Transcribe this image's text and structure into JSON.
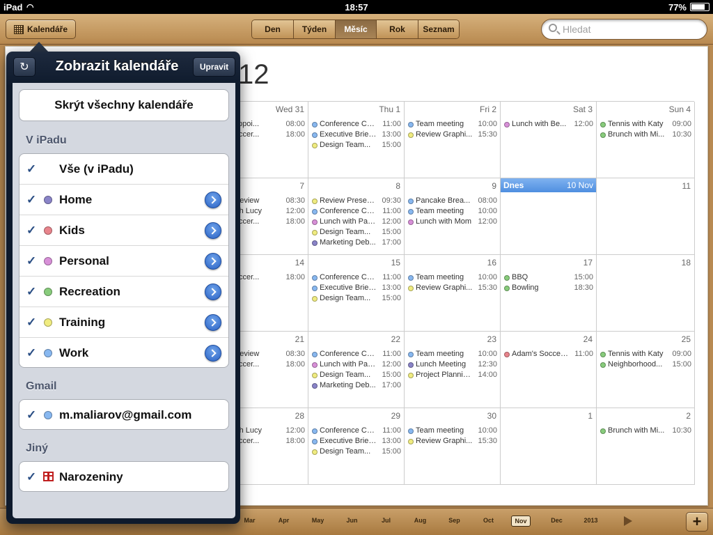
{
  "status_bar": {
    "device": "iPad",
    "time": "18:57",
    "battery": "77%"
  },
  "toolbar": {
    "calendars_label": "Kalendáře",
    "views": [
      {
        "label": "Den",
        "active": false
      },
      {
        "label": "Týden",
        "active": false
      },
      {
        "label": "Měsíc",
        "active": true
      },
      {
        "label": "Rok",
        "active": false
      },
      {
        "label": "Seznam",
        "active": false
      }
    ],
    "search_placeholder": "Hledat"
  },
  "month_view": {
    "title_visible": "12",
    "today_label": "Dnes",
    "today_date": "10 Nov",
    "rows": [
      [
        {
          "date": "Wed 31",
          "events": [
            {
              "title": "r's Appoi...",
              "time": "08:00",
              "cal": "work"
            },
            {
              "title": "s Soccer...",
              "time": "18:00",
              "cal": "kids"
            }
          ]
        },
        {
          "date": "Thu 1",
          "events": [
            {
              "title": "Conference Ca...",
              "time": "11:00",
              "cal": "work"
            },
            {
              "title": "Executive Brief...",
              "time": "13:00",
              "cal": "work"
            },
            {
              "title": "Design Team...",
              "time": "15:00",
              "cal": "training"
            }
          ]
        },
        {
          "date": "Fri 2",
          "events": [
            {
              "title": "Team meeting",
              "time": "10:00",
              "cal": "work"
            },
            {
              "title": "Review Graphi...",
              "time": "15:30",
              "cal": "training"
            }
          ]
        },
        {
          "date": "Sat 3",
          "events": [
            {
              "title": "Lunch with Be...",
              "time": "12:00",
              "cal": "personal"
            }
          ]
        },
        {
          "date": "Sun 4",
          "events": [
            {
              "title": "Tennis with Katy",
              "time": "09:00",
              "cal": "recreation"
            },
            {
              "title": "Brunch with Mi...",
              "time": "10:30",
              "cal": "recreation"
            }
          ]
        }
      ],
      [
        {
          "date": "7",
          "events": [
            {
              "title": "gn Review",
              "time": "08:30",
              "cal": "work"
            },
            {
              "title": "h with Lucy",
              "time": "12:00",
              "cal": "personal"
            },
            {
              "title": "s Soccer...",
              "time": "18:00",
              "cal": "kids"
            }
          ]
        },
        {
          "date": "8",
          "events": [
            {
              "title": "Review Presen...",
              "time": "09:30",
              "cal": "training"
            },
            {
              "title": "Conference Ca...",
              "time": "11:00",
              "cal": "work"
            },
            {
              "title": "Lunch with Pablo",
              "time": "12:00",
              "cal": "personal"
            },
            {
              "title": "Design Team...",
              "time": "15:00",
              "cal": "training"
            },
            {
              "title": "Marketing Deb...",
              "time": "17:00",
              "cal": "home"
            }
          ]
        },
        {
          "date": "9",
          "events": [
            {
              "title": "Pancake Brea...",
              "time": "08:00",
              "cal": "work"
            },
            {
              "title": "Team meeting",
              "time": "10:00",
              "cal": "work"
            },
            {
              "title": "Lunch with Mom",
              "time": "12:00",
              "cal": "personal"
            }
          ]
        },
        {
          "date": "",
          "today": true,
          "events": []
        },
        {
          "date": "11",
          "events": []
        }
      ],
      [
        {
          "date": "14",
          "events": [
            {
              "title": "s Soccer...",
              "time": "18:00",
              "cal": "kids"
            }
          ]
        },
        {
          "date": "15",
          "events": [
            {
              "title": "Conference Ca...",
              "time": "11:00",
              "cal": "work"
            },
            {
              "title": "Executive Brief...",
              "time": "13:00",
              "cal": "work"
            },
            {
              "title": "Design Team...",
              "time": "15:00",
              "cal": "training"
            }
          ]
        },
        {
          "date": "16",
          "events": [
            {
              "title": "Team meeting",
              "time": "10:00",
              "cal": "work"
            },
            {
              "title": "Review Graphi...",
              "time": "15:30",
              "cal": "training"
            }
          ]
        },
        {
          "date": "17",
          "events": [
            {
              "title": "BBQ",
              "time": "15:00",
              "cal": "recreation"
            },
            {
              "title": "Bowling",
              "time": "18:30",
              "cal": "recreation"
            }
          ]
        },
        {
          "date": "18",
          "events": []
        }
      ],
      [
        {
          "date": "21",
          "events": [
            {
              "title": "gn Review",
              "time": "08:30",
              "cal": "work"
            },
            {
              "title": "s Soccer...",
              "time": "18:00",
              "cal": "kids"
            }
          ]
        },
        {
          "date": "22",
          "events": [
            {
              "title": "Conference Ca...",
              "time": "11:00",
              "cal": "work"
            },
            {
              "title": "Lunch with Pablo",
              "time": "12:00",
              "cal": "personal"
            },
            {
              "title": "Design Team...",
              "time": "15:00",
              "cal": "training"
            },
            {
              "title": "Marketing Deb...",
              "time": "17:00",
              "cal": "home"
            }
          ]
        },
        {
          "date": "23",
          "events": [
            {
              "title": "Team meeting",
              "time": "10:00",
              "cal": "work"
            },
            {
              "title": "Lunch Meeting",
              "time": "12:30",
              "cal": "home"
            },
            {
              "title": "Project Plannin...",
              "time": "14:00",
              "cal": "training"
            }
          ]
        },
        {
          "date": "24",
          "events": [
            {
              "title": "Adam's Soccer...",
              "time": "11:00",
              "cal": "kids"
            }
          ]
        },
        {
          "date": "25",
          "events": [
            {
              "title": "Tennis with Katy",
              "time": "09:00",
              "cal": "recreation"
            },
            {
              "title": "Neighborhood...",
              "time": "15:00",
              "cal": "recreation"
            }
          ]
        }
      ],
      [
        {
          "date": "28",
          "events": [
            {
              "title": "h with Lucy",
              "time": "12:00",
              "cal": "personal"
            },
            {
              "title": "s Soccer...",
              "time": "18:00",
              "cal": "kids"
            }
          ]
        },
        {
          "date": "29",
          "events": [
            {
              "title": "Conference Ca...",
              "time": "11:00",
              "cal": "work"
            },
            {
              "title": "Executive Brief...",
              "time": "13:00",
              "cal": "work"
            },
            {
              "title": "Design Team...",
              "time": "15:00",
              "cal": "training"
            }
          ]
        },
        {
          "date": "30",
          "events": [
            {
              "title": "Team meeting",
              "time": "10:00",
              "cal": "work"
            },
            {
              "title": "Review Graphi...",
              "time": "15:30",
              "cal": "training"
            }
          ]
        },
        {
          "date": "1",
          "events": []
        },
        {
          "date": "2",
          "events": [
            {
              "title": "Brunch with Mi...",
              "time": "10:30",
              "cal": "recreation"
            }
          ]
        }
      ]
    ]
  },
  "calendar_colors": {
    "home": "#8a84c8",
    "kids": "#e8848c",
    "personal": "#d890d8",
    "recreation": "#88cc7c",
    "training": "#f0ec80",
    "work": "#88b8f0"
  },
  "popover": {
    "title": "Zobrazit kalendáře",
    "edit_label": "Upravit",
    "refresh_icon": "refresh-icon",
    "hide_all_label": "Skrýt všechny kalendáře",
    "groups": [
      {
        "header": "V iPadu",
        "rows": [
          {
            "label": "Vše (v iPadu)",
            "checked": true,
            "color": null,
            "disclosure": false
          },
          {
            "label": "Home",
            "checked": true,
            "color": "#8a84c8",
            "disclosure": true
          },
          {
            "label": "Kids",
            "checked": true,
            "color": "#e8848c",
            "disclosure": true
          },
          {
            "label": "Personal",
            "checked": true,
            "color": "#d890d8",
            "disclosure": true
          },
          {
            "label": "Recreation",
            "checked": true,
            "color": "#88cc7c",
            "disclosure": true
          },
          {
            "label": "Training",
            "checked": true,
            "color": "#f0ec80",
            "disclosure": true
          },
          {
            "label": "Work",
            "checked": true,
            "color": "#88b8f0",
            "disclosure": true
          }
        ]
      },
      {
        "header": "Gmail",
        "rows": [
          {
            "label": "m.maliarov@gmail.com",
            "checked": true,
            "color": "#88b8f0",
            "disclosure": false
          }
        ]
      },
      {
        "header": "Jiný",
        "rows": [
          {
            "label": "Narozeniny",
            "checked": true,
            "color": null,
            "icon": "gift-icon",
            "disclosure": false
          }
        ]
      }
    ]
  },
  "bottom_bar": {
    "months": [
      "Mar",
      "Apr",
      "May",
      "Jun",
      "Jul",
      "Aug",
      "Sep",
      "Oct",
      "Nov",
      "Dec",
      "2013"
    ],
    "active_month": "Nov",
    "add_label": "+"
  }
}
